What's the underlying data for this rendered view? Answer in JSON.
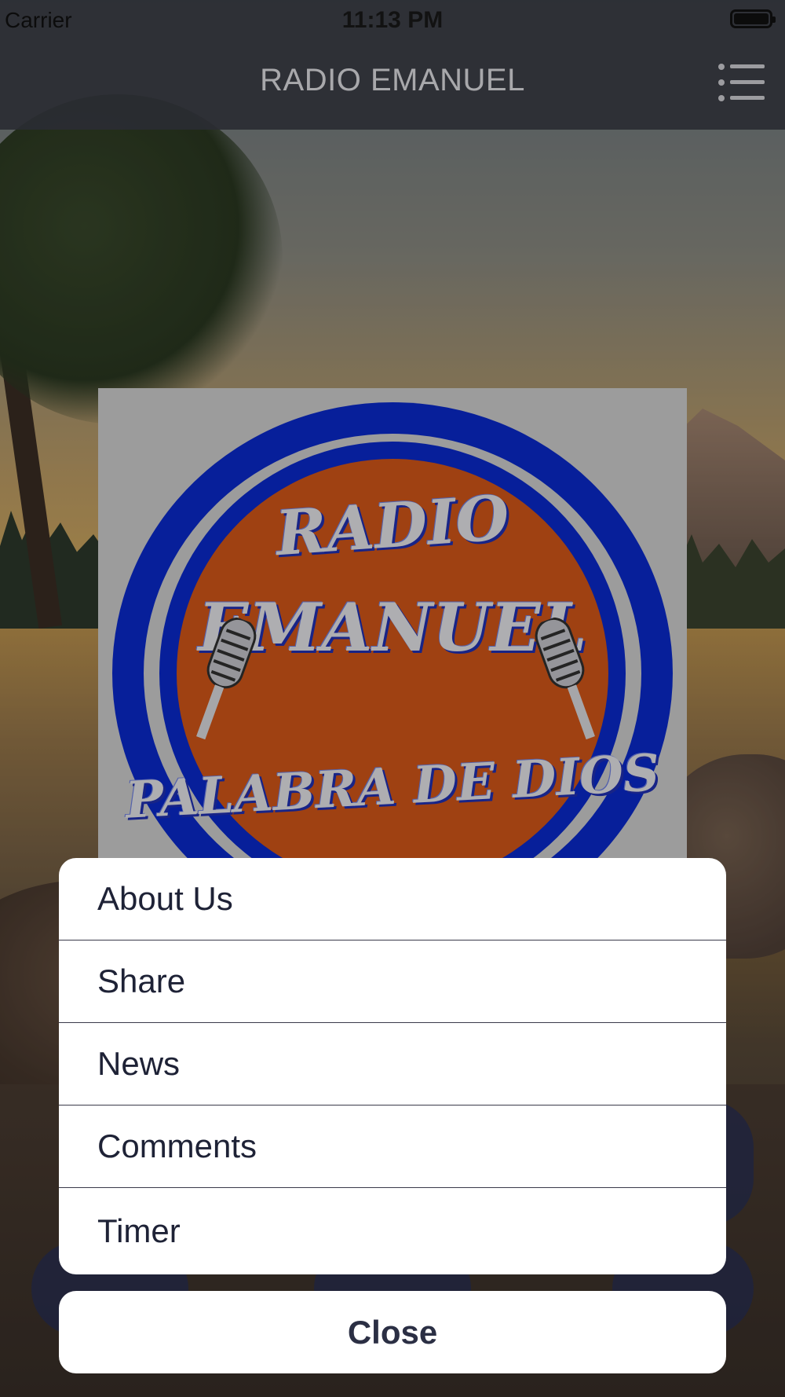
{
  "status_bar": {
    "carrier": "Carrier",
    "time": "11:13 PM"
  },
  "nav": {
    "title": "RADIO EMANUEL",
    "menu_icon": "list-icon"
  },
  "album_art": {
    "logo_lines": [
      "RADIO",
      "EMANUEL",
      "PALABRA DE DIOS"
    ],
    "colors": {
      "ring": "#0b2bd6",
      "disc": "#dd5b1a"
    }
  },
  "action_sheet": {
    "items": [
      {
        "label": "About Us"
      },
      {
        "label": "Share"
      },
      {
        "label": "News"
      },
      {
        "label": "Comments"
      },
      {
        "label": "Timer"
      }
    ],
    "close_label": "Close"
  }
}
